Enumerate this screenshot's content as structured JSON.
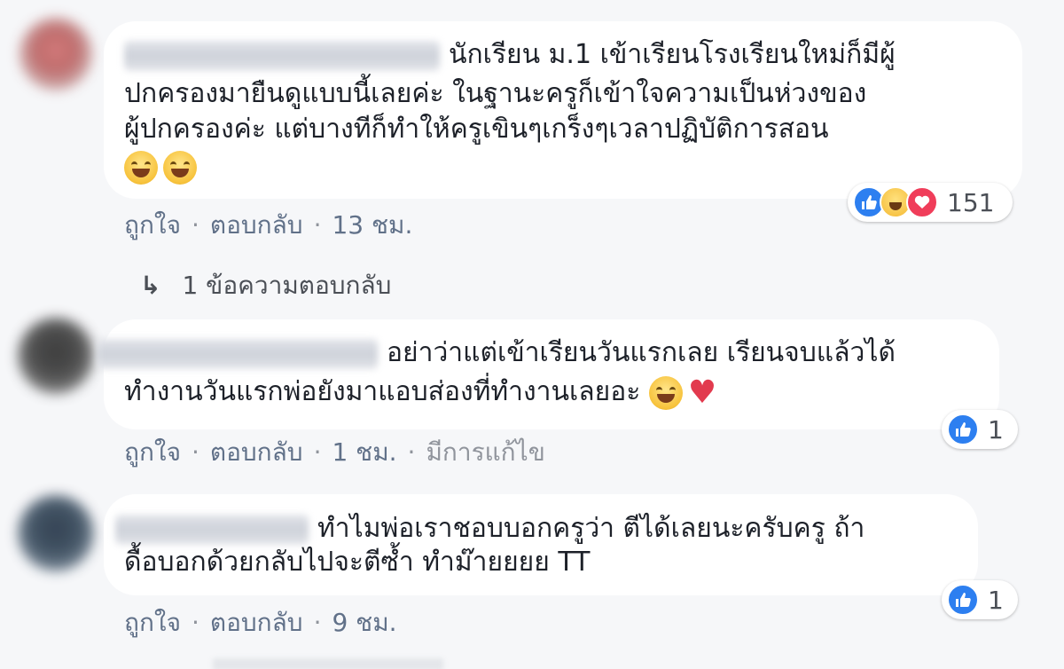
{
  "colors": {
    "page_bg": "#f6f7f9",
    "bubble_bg": "#ffffff",
    "link_gray": "#617189",
    "like_blue": "#2d7ff0",
    "love_red": "#f03d5a"
  },
  "comments": [
    {
      "text_lines": [
        "นักเรียน ม.1 เข้าเรียนโรงเรียนใหม่ก็มีผู้",
        "ปกครองมายืนดูแบบนี้เลยค่ะ ในฐานะครูก็เข้าใจความเป็นห่วงของ",
        "ผู้ปกครองค่ะ แต่บางทีก็ทำให้ครูเขินๆเกร็งๆเวลาปฏิบัติการสอน"
      ],
      "emojis": [
        "grinning-sweat-emoji",
        "grinning-emoji"
      ],
      "actions": {
        "like": "ถูกใจ",
        "reply": "ตอบกลับ",
        "time": "13 ชม."
      },
      "reactions": {
        "icons": [
          "like-icon",
          "haha-icon",
          "love-icon"
        ],
        "count": "151"
      },
      "replies_link": "1 ข้อความตอบกลับ"
    },
    {
      "text_lines": [
        "อย่าว่าแต่เข้าเรียนวันแรกเลย เรียนจบแล้วได้",
        "ทำงานวันแรกพ่อยังมาแอบส่องที่ทำงานเลยอะ"
      ],
      "emojis": [
        "smiling-emoji",
        "heart-emoji"
      ],
      "actions": {
        "like": "ถูกใจ",
        "reply": "ตอบกลับ",
        "time": "1 ชม.",
        "edited": "มีการแก้ไข"
      },
      "reactions": {
        "icons": [
          "like-icon"
        ],
        "count": "1"
      }
    },
    {
      "text_lines": [
        "ทำไมพ่อเราชอบบอกครูว่า ตีได้เลยนะครับครู ถ้า",
        "ดื้อบอกด้วยกลับไปจะตีซ้ำ ทำม๊ายยยย TT"
      ],
      "actions": {
        "like": "ถูกใจ",
        "reply": "ตอบกลับ",
        "time": "9 ชม."
      },
      "reactions": {
        "icons": [
          "like-icon"
        ],
        "count": "1"
      }
    }
  ]
}
